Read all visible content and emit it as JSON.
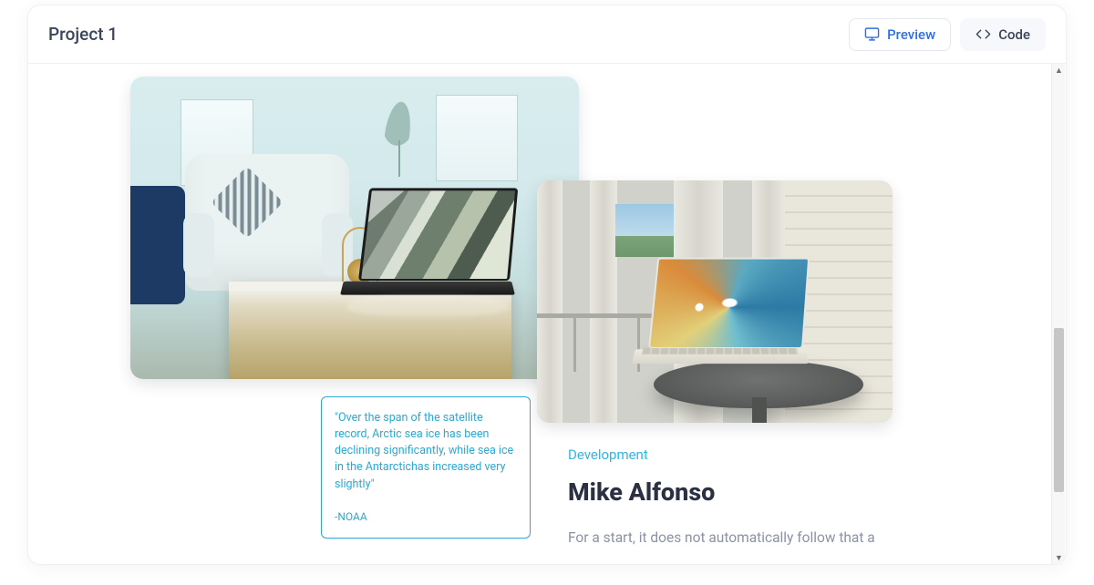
{
  "header": {
    "title": "Project 1",
    "preview_label": "Preview",
    "code_label": "Code"
  },
  "quote": {
    "text": "\"Over the span of the satellite record, Arctic sea ice has been declining significantly, while sea ice in the Antarctichas increased very slightly\"",
    "attribution": "-NOAA"
  },
  "right": {
    "category": "Development",
    "author": "Mike Alfonso",
    "body": "For a start, it does not automatically follow that a"
  }
}
